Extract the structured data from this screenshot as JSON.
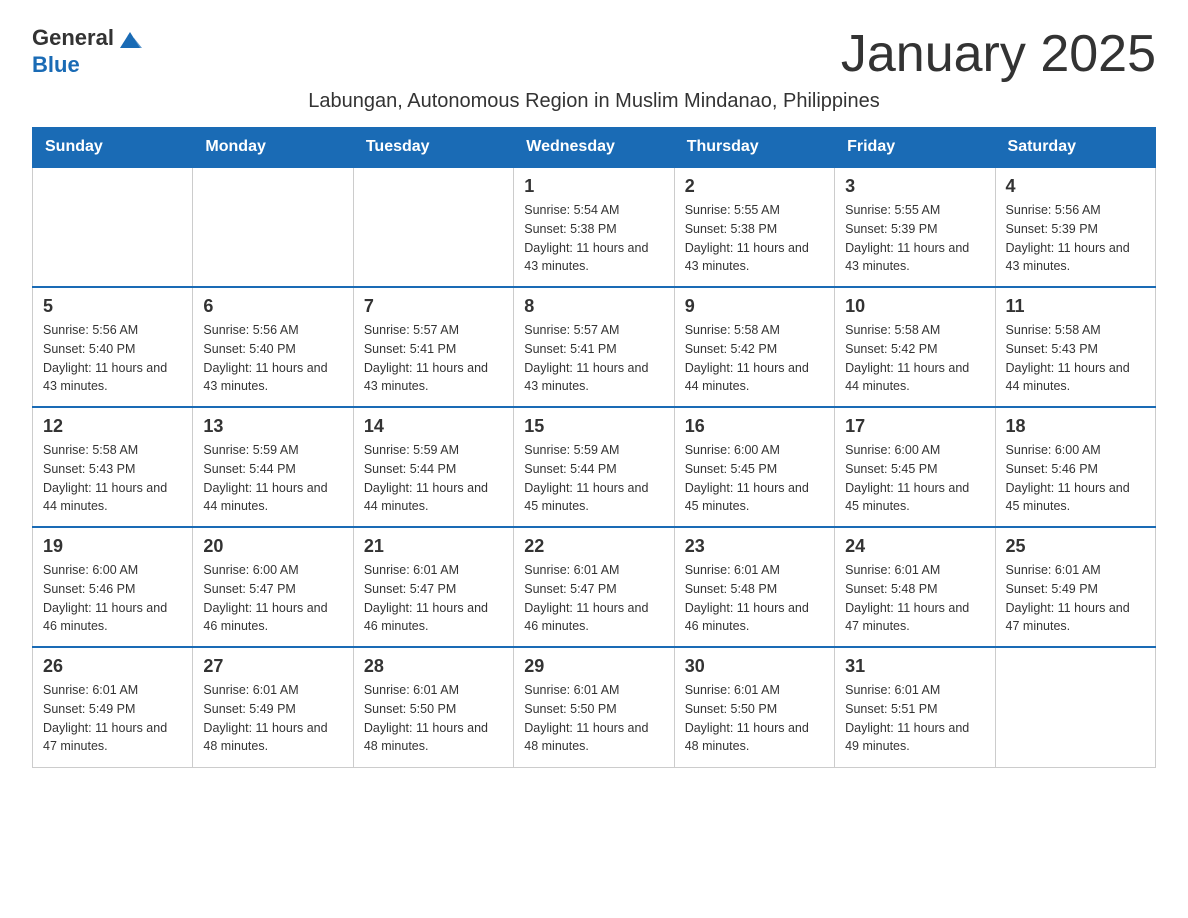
{
  "header": {
    "logo_general": "General",
    "logo_blue": "Blue",
    "month_title": "January 2025",
    "subtitle": "Labungan, Autonomous Region in Muslim Mindanao, Philippines"
  },
  "days_of_week": [
    "Sunday",
    "Monday",
    "Tuesday",
    "Wednesday",
    "Thursday",
    "Friday",
    "Saturday"
  ],
  "weeks": [
    [
      {
        "day": "",
        "info": ""
      },
      {
        "day": "",
        "info": ""
      },
      {
        "day": "",
        "info": ""
      },
      {
        "day": "1",
        "info": "Sunrise: 5:54 AM\nSunset: 5:38 PM\nDaylight: 11 hours and 43 minutes."
      },
      {
        "day": "2",
        "info": "Sunrise: 5:55 AM\nSunset: 5:38 PM\nDaylight: 11 hours and 43 minutes."
      },
      {
        "day": "3",
        "info": "Sunrise: 5:55 AM\nSunset: 5:39 PM\nDaylight: 11 hours and 43 minutes."
      },
      {
        "day": "4",
        "info": "Sunrise: 5:56 AM\nSunset: 5:39 PM\nDaylight: 11 hours and 43 minutes."
      }
    ],
    [
      {
        "day": "5",
        "info": "Sunrise: 5:56 AM\nSunset: 5:40 PM\nDaylight: 11 hours and 43 minutes."
      },
      {
        "day": "6",
        "info": "Sunrise: 5:56 AM\nSunset: 5:40 PM\nDaylight: 11 hours and 43 minutes."
      },
      {
        "day": "7",
        "info": "Sunrise: 5:57 AM\nSunset: 5:41 PM\nDaylight: 11 hours and 43 minutes."
      },
      {
        "day": "8",
        "info": "Sunrise: 5:57 AM\nSunset: 5:41 PM\nDaylight: 11 hours and 43 minutes."
      },
      {
        "day": "9",
        "info": "Sunrise: 5:58 AM\nSunset: 5:42 PM\nDaylight: 11 hours and 44 minutes."
      },
      {
        "day": "10",
        "info": "Sunrise: 5:58 AM\nSunset: 5:42 PM\nDaylight: 11 hours and 44 minutes."
      },
      {
        "day": "11",
        "info": "Sunrise: 5:58 AM\nSunset: 5:43 PM\nDaylight: 11 hours and 44 minutes."
      }
    ],
    [
      {
        "day": "12",
        "info": "Sunrise: 5:58 AM\nSunset: 5:43 PM\nDaylight: 11 hours and 44 minutes."
      },
      {
        "day": "13",
        "info": "Sunrise: 5:59 AM\nSunset: 5:44 PM\nDaylight: 11 hours and 44 minutes."
      },
      {
        "day": "14",
        "info": "Sunrise: 5:59 AM\nSunset: 5:44 PM\nDaylight: 11 hours and 44 minutes."
      },
      {
        "day": "15",
        "info": "Sunrise: 5:59 AM\nSunset: 5:44 PM\nDaylight: 11 hours and 45 minutes."
      },
      {
        "day": "16",
        "info": "Sunrise: 6:00 AM\nSunset: 5:45 PM\nDaylight: 11 hours and 45 minutes."
      },
      {
        "day": "17",
        "info": "Sunrise: 6:00 AM\nSunset: 5:45 PM\nDaylight: 11 hours and 45 minutes."
      },
      {
        "day": "18",
        "info": "Sunrise: 6:00 AM\nSunset: 5:46 PM\nDaylight: 11 hours and 45 minutes."
      }
    ],
    [
      {
        "day": "19",
        "info": "Sunrise: 6:00 AM\nSunset: 5:46 PM\nDaylight: 11 hours and 46 minutes."
      },
      {
        "day": "20",
        "info": "Sunrise: 6:00 AM\nSunset: 5:47 PM\nDaylight: 11 hours and 46 minutes."
      },
      {
        "day": "21",
        "info": "Sunrise: 6:01 AM\nSunset: 5:47 PM\nDaylight: 11 hours and 46 minutes."
      },
      {
        "day": "22",
        "info": "Sunrise: 6:01 AM\nSunset: 5:47 PM\nDaylight: 11 hours and 46 minutes."
      },
      {
        "day": "23",
        "info": "Sunrise: 6:01 AM\nSunset: 5:48 PM\nDaylight: 11 hours and 46 minutes."
      },
      {
        "day": "24",
        "info": "Sunrise: 6:01 AM\nSunset: 5:48 PM\nDaylight: 11 hours and 47 minutes."
      },
      {
        "day": "25",
        "info": "Sunrise: 6:01 AM\nSunset: 5:49 PM\nDaylight: 11 hours and 47 minutes."
      }
    ],
    [
      {
        "day": "26",
        "info": "Sunrise: 6:01 AM\nSunset: 5:49 PM\nDaylight: 11 hours and 47 minutes."
      },
      {
        "day": "27",
        "info": "Sunrise: 6:01 AM\nSunset: 5:49 PM\nDaylight: 11 hours and 48 minutes."
      },
      {
        "day": "28",
        "info": "Sunrise: 6:01 AM\nSunset: 5:50 PM\nDaylight: 11 hours and 48 minutes."
      },
      {
        "day": "29",
        "info": "Sunrise: 6:01 AM\nSunset: 5:50 PM\nDaylight: 11 hours and 48 minutes."
      },
      {
        "day": "30",
        "info": "Sunrise: 6:01 AM\nSunset: 5:50 PM\nDaylight: 11 hours and 48 minutes."
      },
      {
        "day": "31",
        "info": "Sunrise: 6:01 AM\nSunset: 5:51 PM\nDaylight: 11 hours and 49 minutes."
      },
      {
        "day": "",
        "info": ""
      }
    ]
  ]
}
